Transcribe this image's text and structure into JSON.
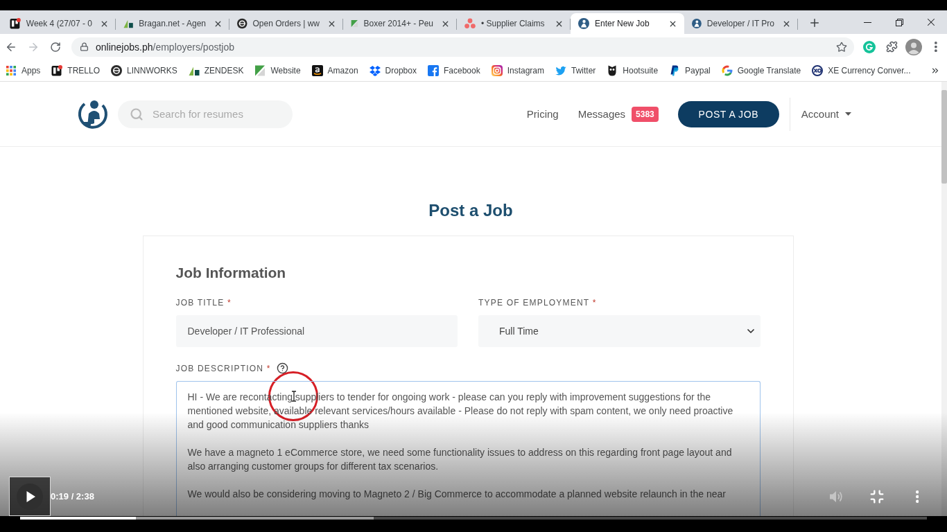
{
  "video": {
    "paused": true,
    "time": "0:19 / 2:38",
    "progress": {
      "level": 0.128
    },
    "buffered": {
      "level": 0.39
    }
  },
  "browser": {
    "tabs": [
      {
        "title": "Week 4 (27/07 - 0",
        "selected": false
      },
      {
        "title": "Bragan.net - Agen",
        "selected": false
      },
      {
        "title": "Open Orders | ww",
        "selected": false
      },
      {
        "title": "Boxer 2014+ - Peu",
        "selected": false
      },
      {
        "title": "• Supplier Claims",
        "selected": false
      },
      {
        "title": "Enter New Job",
        "selected": true
      },
      {
        "title": "Developer / IT Pro",
        "selected": false
      }
    ],
    "address_bar": {
      "host": "onlinejobs.ph",
      "path": "/employers/postjob"
    },
    "bookmarks": [
      {
        "label": "Apps"
      },
      {
        "label": "TRELLO"
      },
      {
        "label": "LINNWORKS"
      },
      {
        "label": "ZENDESK"
      },
      {
        "label": "Website"
      },
      {
        "label": "Amazon"
      },
      {
        "label": "Dropbox"
      },
      {
        "label": "Facebook"
      },
      {
        "label": "Instagram"
      },
      {
        "label": "Twitter"
      },
      {
        "label": "Hootsuite"
      },
      {
        "label": "Paypal"
      },
      {
        "label": "Google Translate"
      },
      {
        "label": "XE Currency Conver..."
      }
    ]
  },
  "site_header": {
    "search": {
      "placeholder": "Search for resumes"
    },
    "nav": [
      {
        "label": "Pricing"
      },
      {
        "label": "Messages",
        "badge": "5383"
      }
    ],
    "post_button": "POST A JOB",
    "account": "Account"
  },
  "form": {
    "title": "Post a Job",
    "section": "Job Information",
    "fields": [
      {
        "kind": "text",
        "label": "JOB TITLE",
        "required_mark": "*",
        "value": "Developer / IT Professional"
      },
      {
        "kind": "select",
        "label": "TYPE OF EMPLOYMENT",
        "required_mark": "*",
        "value": "Full Time"
      },
      {
        "kind": "textarea",
        "label": "JOB DESCRIPTION",
        "required_mark": "*",
        "help": true,
        "focused": true,
        "value": "HI - We are recontacting suppliers to tender for ongoing work - please can you reply with improvement suggestions for the mentioned website, available relevant services/hours available - Please do not reply with spam content, we only need proactive and good communication suppliers thanks\n\nWe have a magneto 1 eCommerce store, we need some functionality issues to address on this regarding front page layout and also arranging customer groups for different tax scenarios.\n\nWe would also be considering moving to Magneto 2 / Big Commerce to accommodate a planned website relaunch in the near"
      }
    ]
  }
}
